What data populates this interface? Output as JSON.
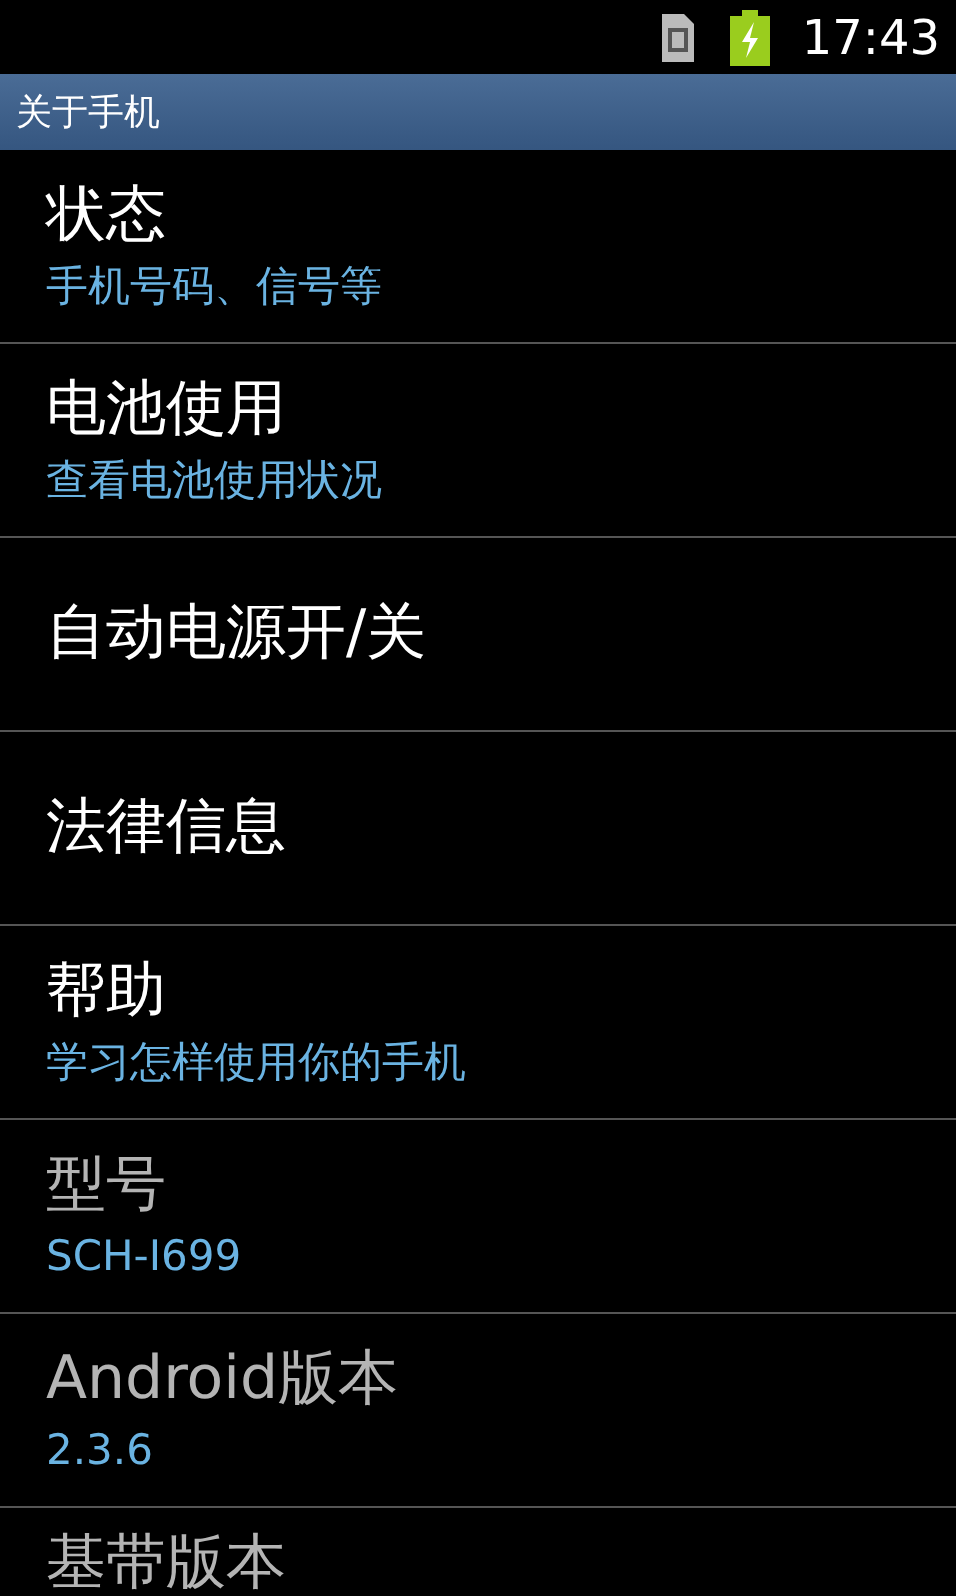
{
  "status_bar": {
    "time": "17:43"
  },
  "header": {
    "title": "关于手机"
  },
  "items": [
    {
      "title": "状态",
      "summary": "手机号码、信号等",
      "disabled": false
    },
    {
      "title": "电池使用",
      "summary": "查看电池使用状况",
      "disabled": false
    },
    {
      "title": "自动电源开/关",
      "disabled": false
    },
    {
      "title": "法律信息",
      "disabled": false
    },
    {
      "title": "帮助",
      "summary": "学习怎样使用你的手机",
      "disabled": false
    },
    {
      "title": "型号",
      "summary": "SCH-I699",
      "disabled": true
    },
    {
      "title": "Android版本",
      "summary": "2.3.6",
      "disabled": true
    },
    {
      "title": "基带版本",
      "disabled": true
    }
  ]
}
